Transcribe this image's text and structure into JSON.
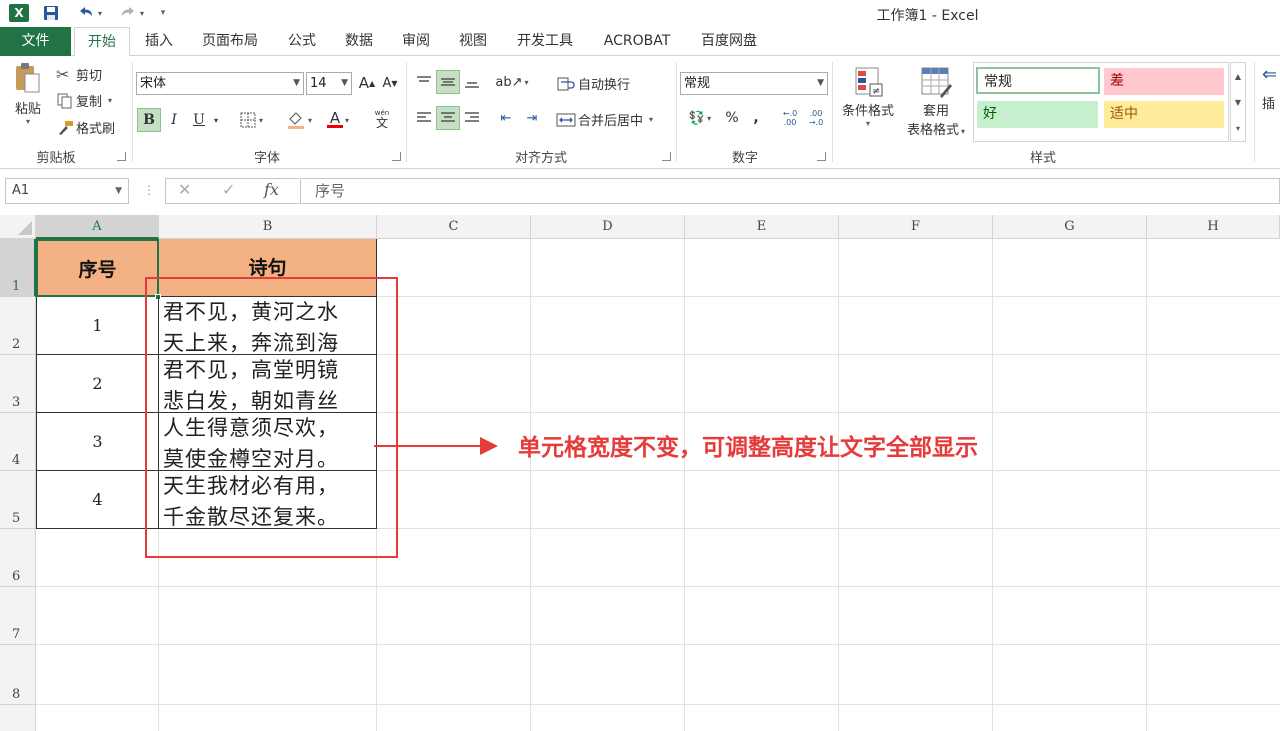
{
  "window": {
    "title": "工作簿1 - Excel"
  },
  "quick_access": {
    "logo_text": "X",
    "save_icon": "save-icon",
    "undo_icon": "undo-icon",
    "redo_icon": "redo-icon"
  },
  "tabs": [
    {
      "label": "文件"
    },
    {
      "label": "开始"
    },
    {
      "label": "插入"
    },
    {
      "label": "页面布局"
    },
    {
      "label": "公式"
    },
    {
      "label": "数据"
    },
    {
      "label": "审阅"
    },
    {
      "label": "视图"
    },
    {
      "label": "开发工具"
    },
    {
      "label": "ACROBAT"
    },
    {
      "label": "百度网盘"
    }
  ],
  "ribbon": {
    "clipboard": {
      "paste": "粘贴",
      "cut": "剪切",
      "copy": "复制",
      "format_painter": "格式刷",
      "group": "剪贴板"
    },
    "font": {
      "name": "宋体",
      "size": "14",
      "grow": "A",
      "shrink": "A",
      "bold": "B",
      "italic": "I",
      "underline": "U",
      "font_color": "A",
      "phonetic": "wén",
      "phonetic_char": "文",
      "group": "字体"
    },
    "alignment": {
      "wrap_text": "自动换行",
      "merge_center": "合并后居中",
      "group": "对齐方式"
    },
    "number": {
      "format": "常规",
      "percent": "%",
      "comma": ",",
      "group": "数字"
    },
    "styles": {
      "conditional": "条件格式",
      "table_format_1": "套用",
      "table_format_2": "表格格式",
      "cells": [
        {
          "label": "常规",
          "bg": "#ffffff",
          "border": "#5aa46e"
        },
        {
          "label": "差",
          "bg": "#ffc7ce",
          "color": "#9c0006"
        },
        {
          "label": "好",
          "bg": "#c6efce",
          "color": "#006100"
        },
        {
          "label": "适中",
          "bg": "#ffeb9c",
          "color": "#9c5700"
        }
      ],
      "group": "样式"
    },
    "insert_partial": "插"
  },
  "formula_bar": {
    "name_box": "A1",
    "cancel": "✕",
    "enter": "✓",
    "fx": "fx",
    "content": "序号"
  },
  "grid": {
    "columns": [
      "A",
      "B",
      "C",
      "D",
      "E",
      "F",
      "G",
      "H"
    ],
    "rows": [
      "1",
      "2",
      "3",
      "4",
      "5",
      "6",
      "7",
      "8"
    ],
    "header": {
      "a": "序号",
      "b": "诗句",
      "fill": "#f4b183"
    },
    "data": [
      {
        "num": "1",
        "line1": "君不见，黄河之水",
        "line2": "天上来，奔流到海"
      },
      {
        "num": "2",
        "line1": "君不见，高堂明镜",
        "line2": "悲白发，朝如青丝"
      },
      {
        "num": "3",
        "line1": "人生得意须尽欢，",
        "line2": "莫使金樽空对月。"
      },
      {
        "num": "4",
        "line1": "天生我材必有用，",
        "line2": "千金散尽还复来。"
      }
    ]
  },
  "annotation": {
    "text": "单元格宽度不变，可调整高度让文字全部显示",
    "color": "#e63b3b"
  }
}
